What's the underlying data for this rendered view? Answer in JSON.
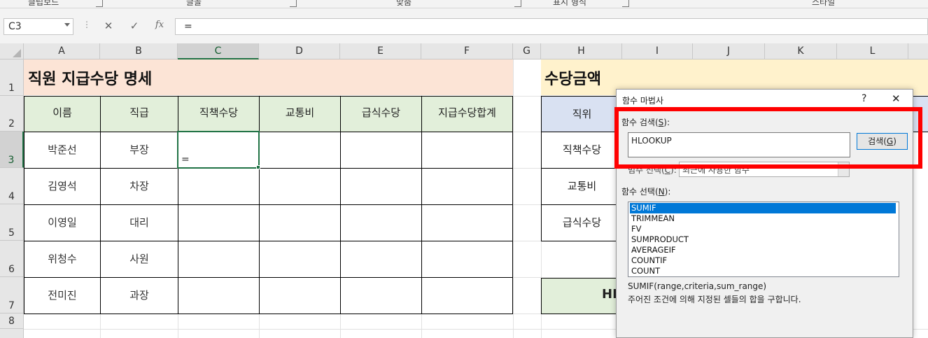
{
  "ribbon": {
    "groups": [
      "클립보드",
      "글꼴",
      "맞춤",
      "표시 형식",
      "스타일"
    ]
  },
  "formula_bar": {
    "name_box": "C3",
    "cancel_icon": "✕",
    "enter_icon": "✓",
    "fx_label": "fx",
    "formula": "="
  },
  "columns": [
    "A",
    "B",
    "C",
    "D",
    "E",
    "F",
    "G",
    "H",
    "I",
    "J",
    "K",
    "L"
  ],
  "rows": [
    "1",
    "2",
    "3",
    "4",
    "5",
    "6",
    "7",
    "8"
  ],
  "sheet": {
    "title": "직원 지급수당 명세",
    "headers": [
      "이름",
      "직급",
      "직책수당",
      "교통비",
      "급식수당",
      "지급수당합계"
    ],
    "data": [
      {
        "name": "박준선",
        "rank": "부장"
      },
      {
        "name": "김영석",
        "rank": "차장"
      },
      {
        "name": "이영일",
        "rank": "대리"
      },
      {
        "name": "위청수",
        "rank": "사원"
      },
      {
        "name": "전미진",
        "rank": "과장"
      }
    ],
    "active_value": "="
  },
  "allowance": {
    "title": "수당금액",
    "header": "직위",
    "items": [
      "직책수당",
      "교통비",
      "급식수당"
    ],
    "partial_label": "HI"
  },
  "dialog": {
    "title": "함수 마법사",
    "help": "?",
    "close": "✕",
    "search_label": "함수 검색(",
    "search_key": "S",
    "search_label_end": "):",
    "search_value": "HLOOKUP",
    "search_button": "검색(",
    "search_button_key": "G",
    "search_button_end": ")",
    "category_label": "범주 선택(",
    "category_key": "C",
    "category_label_end": "):",
    "category_value": "최근에 사용한 함수",
    "select_label": "함수 선택(",
    "select_key": "N",
    "select_label_end": "):",
    "functions": [
      "SUMIF",
      "TRIMMEAN",
      "FV",
      "SUMPRODUCT",
      "AVERAGEIF",
      "COUNTIF",
      "COUNT"
    ],
    "selected_function": "SUMIF",
    "signature": "SUMIF(range,criteria,sum_range)",
    "description": "주어진 조건에 의해 지정된 셀들의 합을 구합니다."
  },
  "colors": {
    "title_band": "#fce4d6",
    "header_fill": "#e2efda",
    "allowance_band": "#fff2cc",
    "allowance_header": "#d9e1f2",
    "selection_green": "#217346",
    "highlight_red": "#ff0000",
    "list_selection": "#0078d7"
  }
}
